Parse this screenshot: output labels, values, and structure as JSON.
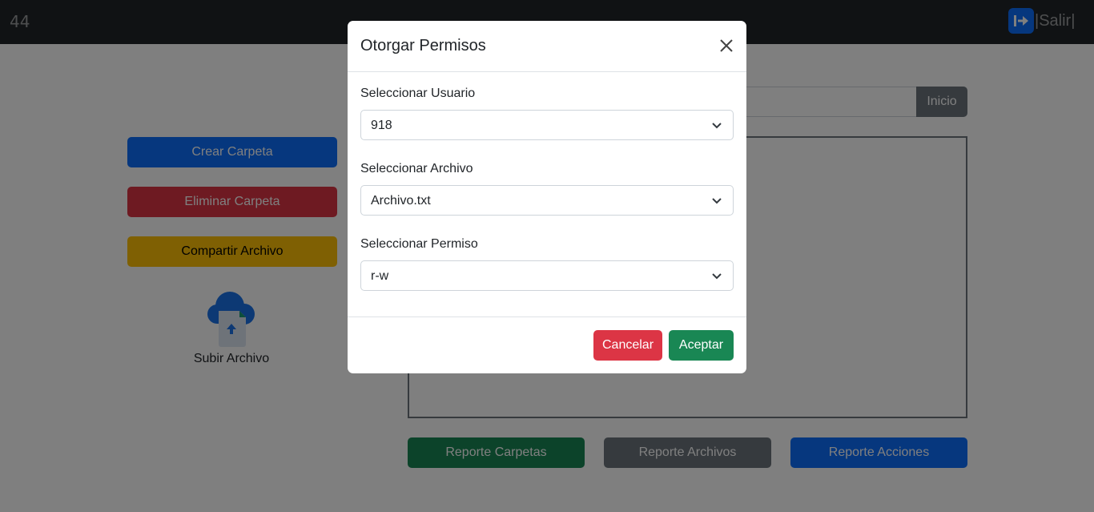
{
  "topbar": {
    "user_id": "44",
    "logout_label": "|Salir|"
  },
  "sidebar": {
    "create_folder": "Crear Carpeta",
    "delete_folder": "Eliminar Carpeta",
    "share_file": "Compartir Archivo",
    "upload_file": "Subir Archivo"
  },
  "main": {
    "path_value": "",
    "home_button": "Inicio",
    "report_folders": "Reporte Carpetas",
    "report_files": "Reporte Archivos",
    "report_actions": "Reporte Acciones"
  },
  "modal": {
    "title": "Otorgar Permisos",
    "user_label": "Seleccionar Usuario",
    "user_value": "918",
    "file_label": "Seleccionar Archivo",
    "file_value": "Archivo.txt",
    "permission_label": "Seleccionar Permiso",
    "permission_value": "r-w",
    "cancel": "Cancelar",
    "accept": "Aceptar"
  },
  "colors": {
    "topbar": "#212529",
    "primary": "#0d6efd",
    "danger": "#dc3545",
    "warning": "#ffc107",
    "success": "#198754",
    "secondary": "#6c757d"
  },
  "icons": [
    "logout-icon",
    "cloud-upload-icon",
    "close-icon",
    "chevron-down-icon"
  ]
}
